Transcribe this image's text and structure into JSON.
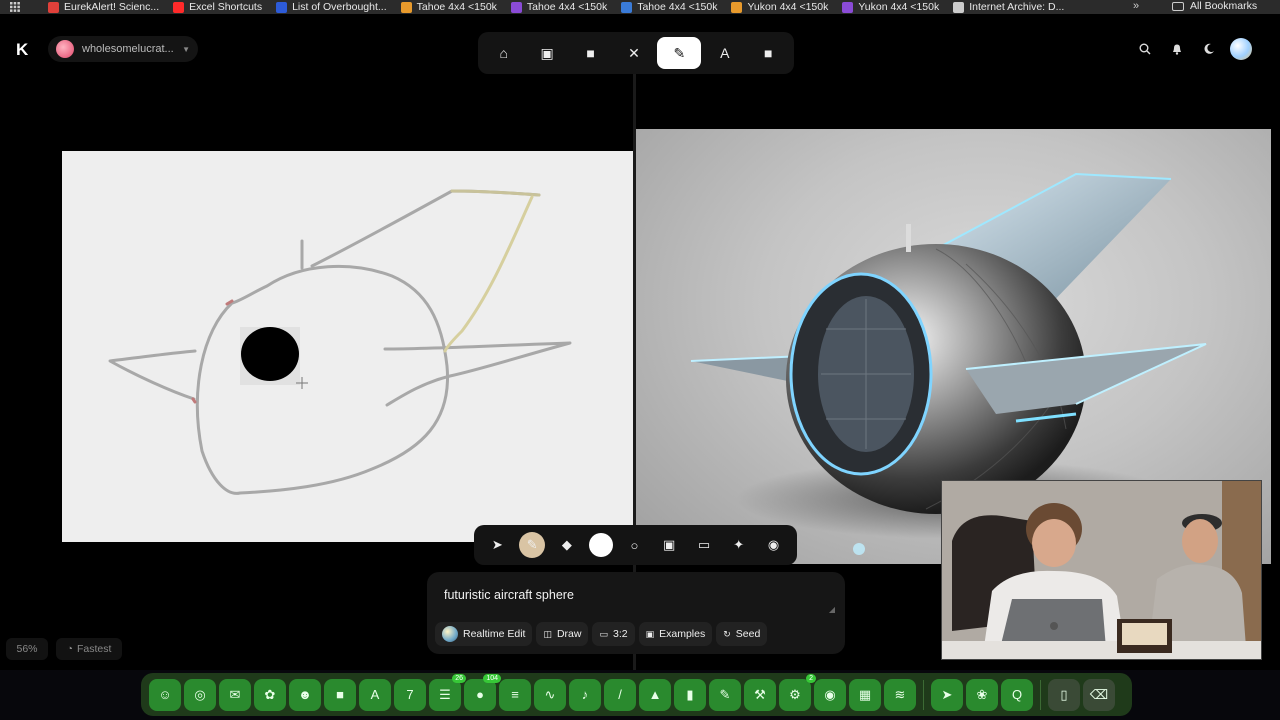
{
  "bookmarks": [
    {
      "label": "EurekAlert! Scienc...",
      "color": "#e0403a"
    },
    {
      "label": "Excel Shortcuts",
      "color": "#ff2a2a"
    },
    {
      "label": "List of Overbought...",
      "color": "#2d5bd8"
    },
    {
      "label": "Tahoe 4x4 <150k",
      "color": "#e89a2c"
    },
    {
      "label": "Tahoe 4x4 <150k",
      "color": "#8a4bd6"
    },
    {
      "label": "Tahoe 4x4 <150k",
      "color": "#3a7bd8"
    },
    {
      "label": "Yukon 4x4 <150k",
      "color": "#e89a2c"
    },
    {
      "label": "Yukon 4x4 <150k",
      "color": "#8a4bd6"
    },
    {
      "label": "Internet Archive: D...",
      "color": "#cccccc"
    }
  ],
  "bookmarks_more": "»",
  "all_bookmarks": "All Bookmarks",
  "app": {
    "logo": "K",
    "account_name": "wholesomelucrat...",
    "modes": [
      {
        "icon": "home-icon",
        "glyph": "⌂"
      },
      {
        "icon": "image-icon",
        "glyph": "▣"
      },
      {
        "icon": "video-icon",
        "glyph": "■"
      },
      {
        "icon": "magic-wand-icon",
        "glyph": "✕"
      },
      {
        "icon": "brush-icon",
        "glyph": "✎"
      },
      {
        "icon": "text-icon",
        "glyph": "A"
      },
      {
        "icon": "folder-icon",
        "glyph": "■"
      }
    ],
    "active_mode": 4
  },
  "toolbar": {
    "tools": [
      {
        "icon": "cursor-icon",
        "glyph": "➤"
      },
      {
        "icon": "brush-tool-icon",
        "glyph": "✎"
      },
      {
        "icon": "eraser-icon",
        "glyph": "◆"
      },
      {
        "icon": "color-swatch-icon",
        "glyph": ""
      },
      {
        "icon": "circle-shape-icon",
        "glyph": "○"
      },
      {
        "icon": "image-upload-icon",
        "glyph": "▣"
      },
      {
        "icon": "folder-open-icon",
        "glyph": "▭"
      },
      {
        "icon": "sparkle-icon",
        "glyph": "✦"
      },
      {
        "icon": "camera-icon",
        "glyph": "◉"
      }
    ]
  },
  "prompt": {
    "text": "futuristic aircraft sphere",
    "options": [
      {
        "label": "Realtime Edit",
        "icon": "globe-icon"
      },
      {
        "label": "Draw",
        "icon": "draw-icon"
      },
      {
        "label": "3:2",
        "icon": "aspect-icon"
      },
      {
        "label": "Examples",
        "icon": "examples-icon"
      },
      {
        "label": "Seed",
        "icon": "seed-icon"
      }
    ]
  },
  "status": {
    "zoom": "56%",
    "speed": "Fastest"
  },
  "dock": {
    "icons": [
      "finder-icon",
      "safari-icon",
      "mail-icon",
      "settings-icon",
      "contacts-icon",
      "facetime-icon",
      "appstore-icon",
      "calendar-icon",
      "reminders-icon",
      "messages-icon",
      "notes-icon",
      "freeform-icon",
      "music-icon",
      "pencil-icon",
      "keynote-icon",
      "numbers-icon",
      "pages-icon",
      "xcode-icon",
      "system-prefs-icon",
      "chrome-icon",
      "calculator-icon",
      "spotify-icon",
      "telegram-icon",
      "photo-app-icon",
      "quicktime-icon",
      "document-icon",
      "trash-icon"
    ],
    "badges": {
      "reminders-icon": "26",
      "messages-icon": "104",
      "system-prefs-icon": "2"
    },
    "calendar_day": "7"
  }
}
